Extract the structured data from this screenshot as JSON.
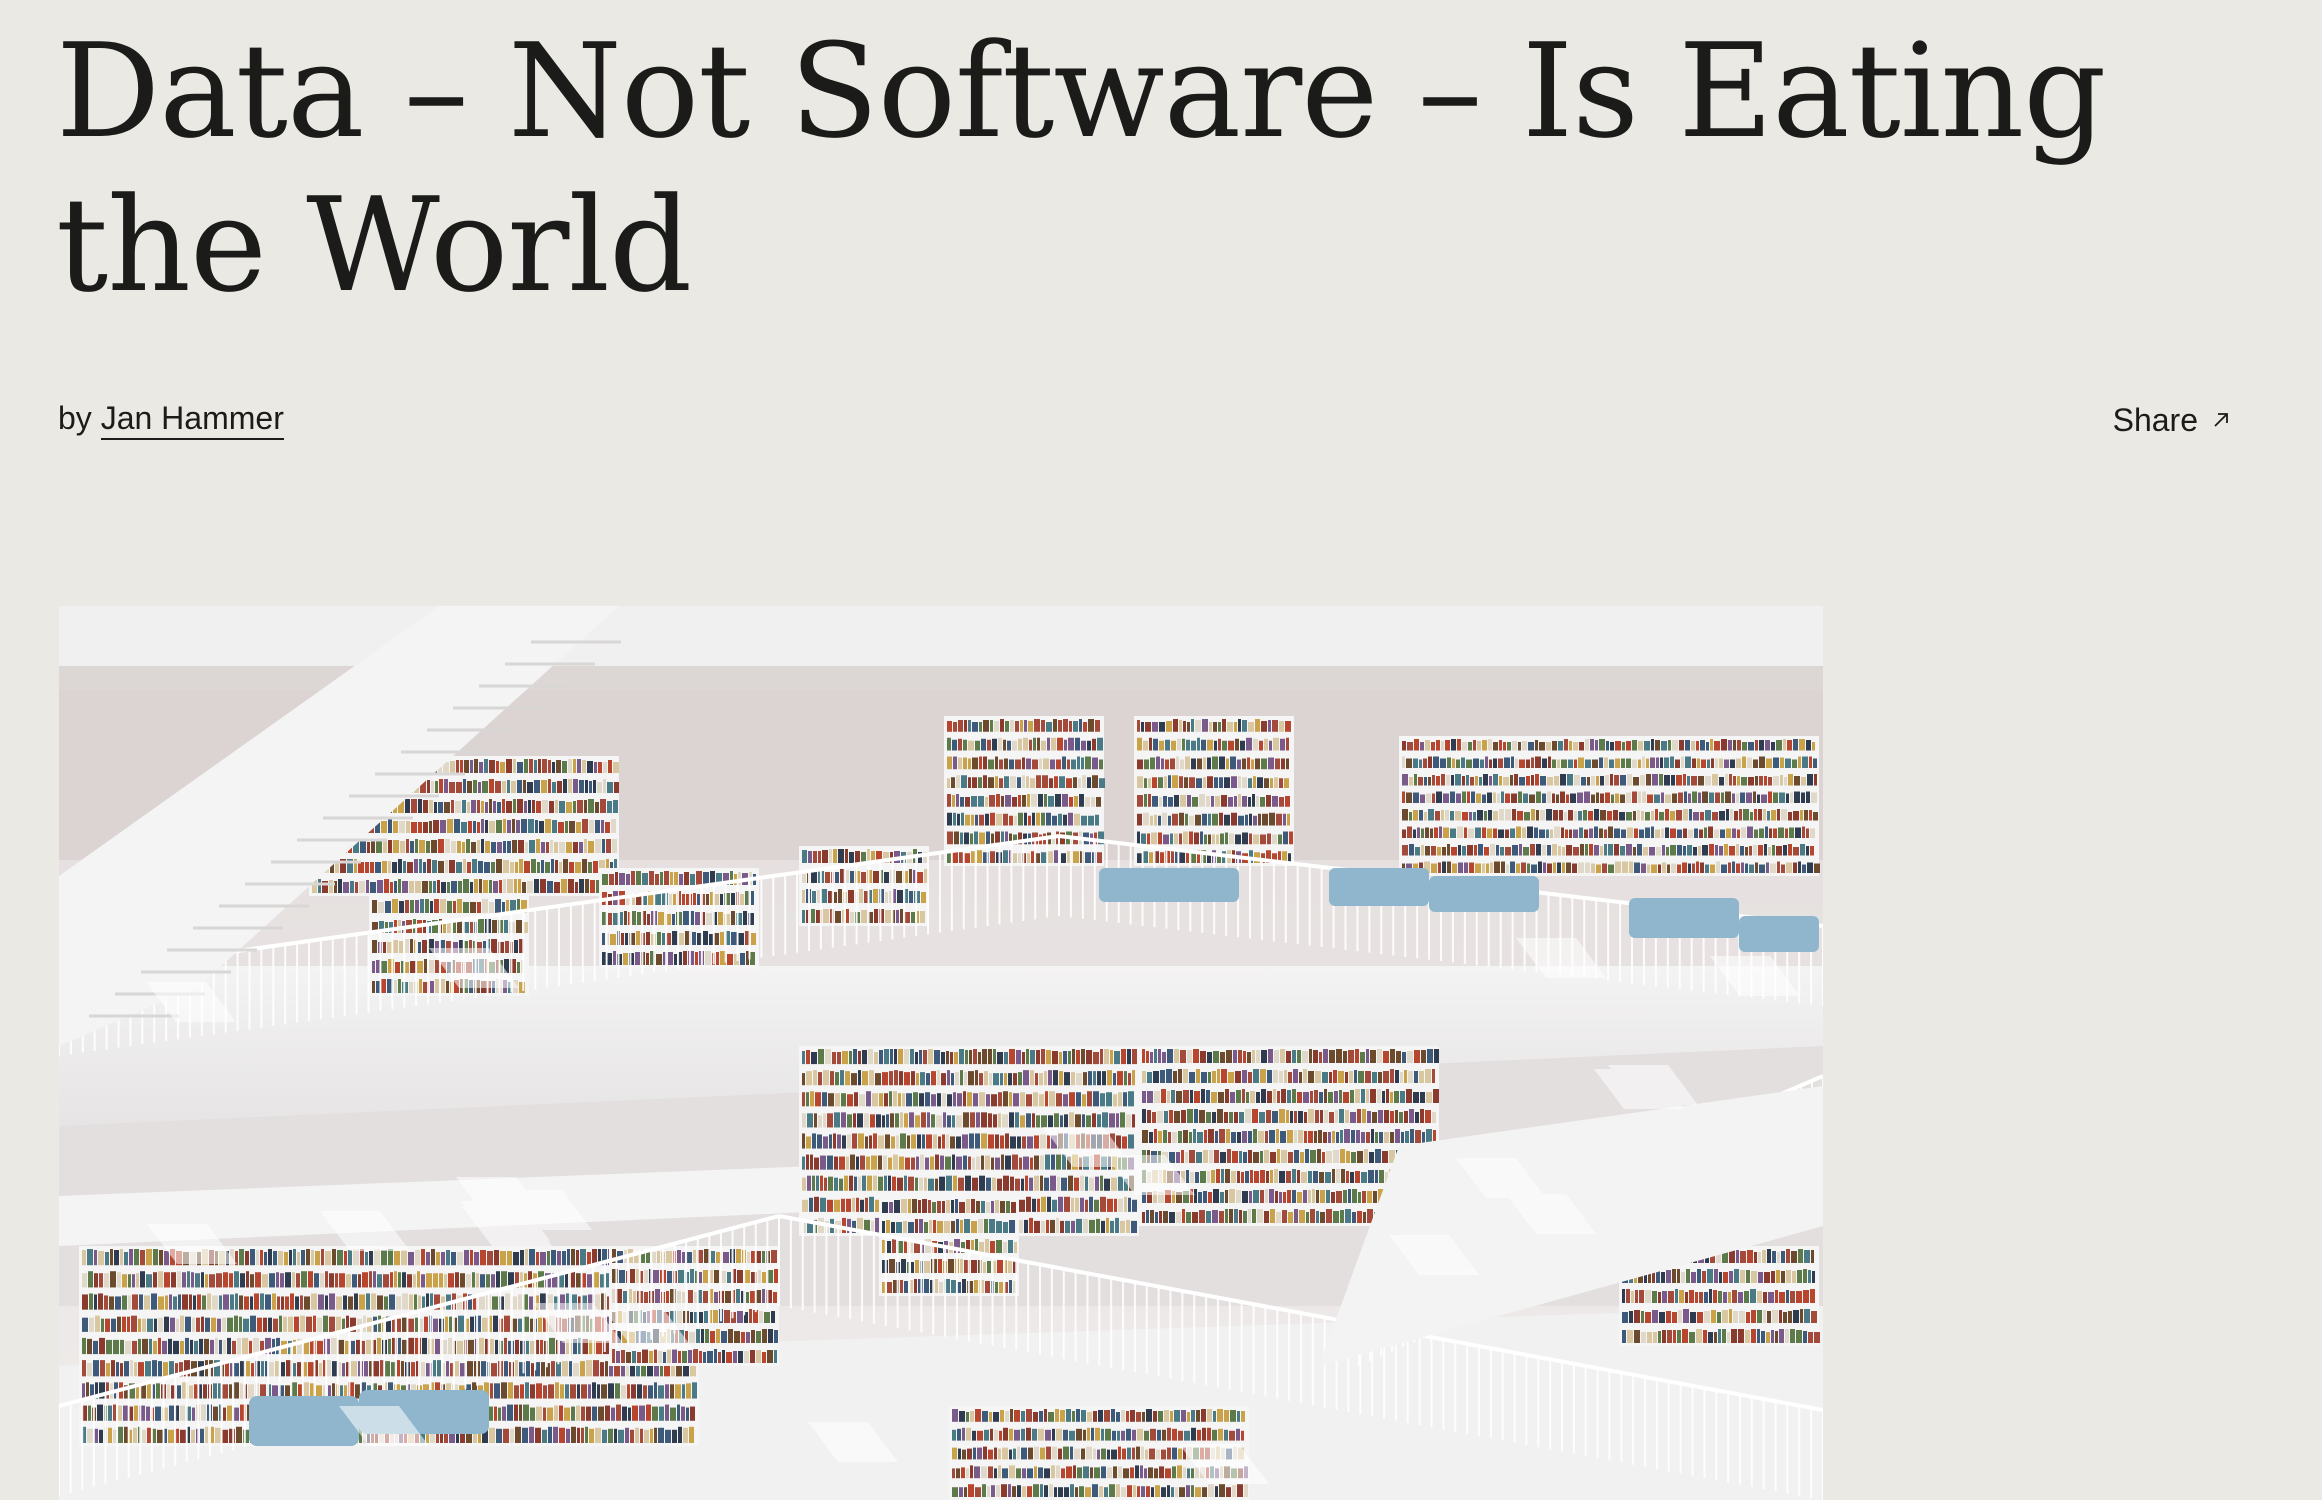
{
  "article": {
    "title": "Data – Not Software – Is Eating the World",
    "byline_prefix": "by",
    "author": "Jan Hammer"
  },
  "share": {
    "label": "Share",
    "icon": "arrow-up-right-icon"
  },
  "hero_image": {
    "description_icon": "library-photo",
    "alt": ""
  },
  "colors": {
    "background": "#ebe9e3",
    "text": "#1b1b19",
    "bench_blue": "#8fb6cc"
  }
}
